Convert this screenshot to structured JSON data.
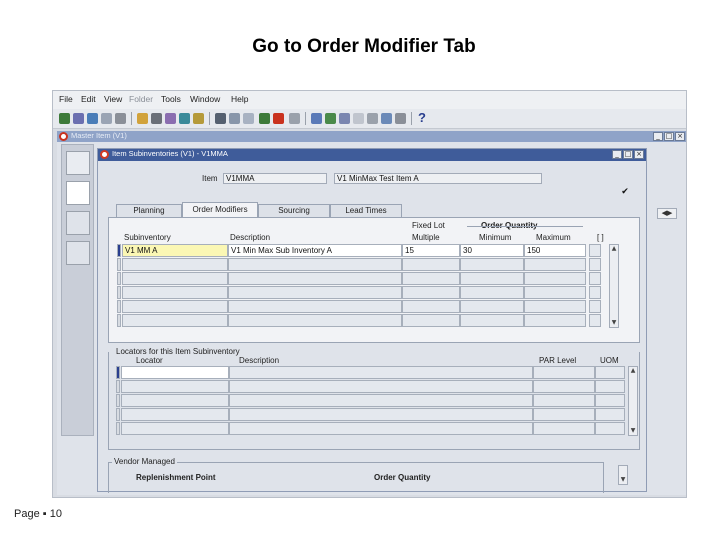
{
  "slide": {
    "title": "Go to Order Modifier Tab",
    "page_label": "Page ▪ 10"
  },
  "app": {
    "menu": [
      "File",
      "Edit",
      "View",
      "Folder",
      "Tools",
      "Window",
      "Help"
    ],
    "help_glyph": "?",
    "master_window_title": "Master Item (V1)",
    "nav_arrows": "◀▶",
    "subwindow": {
      "title": "Item Subinventories (V1) - V1MMA",
      "item_label": "Item",
      "item_value": "V1MMA",
      "item_description": "V1 MinMax Test Item A",
      "checkbox_mark": "✔",
      "tabs": [
        {
          "label": "Planning",
          "active": false
        },
        {
          "label": "Order Modifiers",
          "active": true
        },
        {
          "label": "Sourcing",
          "active": false
        },
        {
          "label": "Lead Times",
          "active": false
        }
      ],
      "headers": {
        "subinventory": "Subinventory",
        "description": "Description",
        "fixed_lot_line1": "Fixed Lot",
        "fixed_lot_line2": "Multiple",
        "order_quantity": "Order Quantity",
        "minimum": "Minimum",
        "maximum": "Maximum",
        "bracket": "[ ]"
      },
      "rows": [
        {
          "subinventory": "V1 MM A",
          "description": "V1 Min Max Sub Inventory A",
          "fixed_lot": "15",
          "minimum": "30",
          "maximum": "150"
        },
        {
          "subinventory": "",
          "description": "",
          "fixed_lot": "",
          "minimum": "",
          "maximum": ""
        },
        {
          "subinventory": "",
          "description": "",
          "fixed_lot": "",
          "minimum": "",
          "maximum": ""
        },
        {
          "subinventory": "",
          "description": "",
          "fixed_lot": "",
          "minimum": "",
          "maximum": ""
        },
        {
          "subinventory": "",
          "description": "",
          "fixed_lot": "",
          "minimum": "",
          "maximum": ""
        },
        {
          "subinventory": "",
          "description": "",
          "fixed_lot": "",
          "minimum": "",
          "maximum": ""
        }
      ],
      "locators": {
        "section_label": "Locators for this Item Subinventory",
        "headers": {
          "locator": "Locator",
          "description": "Description",
          "par_level": "PAR Level",
          "uom": "UOM"
        },
        "rows": [
          {
            "locator": "",
            "description": "",
            "par_level": "",
            "uom": ""
          },
          {
            "locator": "",
            "description": "",
            "par_level": "",
            "uom": ""
          },
          {
            "locator": "",
            "description": "",
            "par_level": "",
            "uom": ""
          },
          {
            "locator": "",
            "description": "",
            "par_level": "",
            "uom": ""
          },
          {
            "locator": "",
            "description": "",
            "par_level": "",
            "uom": ""
          }
        ]
      },
      "vendor_managed": {
        "section_label": "Vendor Managed",
        "replenishment_point": "Replenishment Point",
        "order_quantity": "Order Quantity"
      }
    }
  }
}
